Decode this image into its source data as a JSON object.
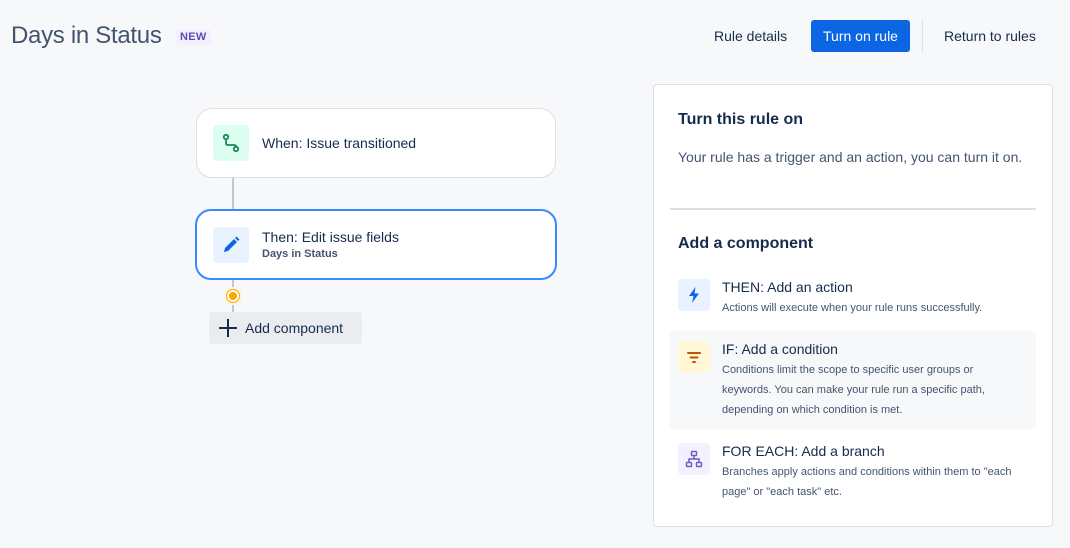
{
  "header": {
    "title": "Days in Status",
    "badge": "NEW",
    "rule_details_label": "Rule details",
    "turn_on_label": "Turn on rule",
    "return_label": "Return to rules"
  },
  "canvas": {
    "trigger": {
      "title": "When: Issue transitioned",
      "icon": "transition-icon"
    },
    "action": {
      "title": "Then: Edit issue fields",
      "subtitle": "Days in Status",
      "icon": "pencil-icon"
    },
    "add_component_label": "Add component"
  },
  "panel": {
    "title": "Turn this rule on",
    "description": "Your rule has a trigger and an action, you can turn it on.",
    "section_title": "Add a component",
    "components": [
      {
        "title": "THEN: Add an action",
        "description": "Actions will execute when your rule runs successfully.",
        "icon": "lightning-icon"
      },
      {
        "title": "IF: Add a condition",
        "description": "Conditions limit the scope to specific user groups or keywords. You can make your rule run a specific path, depending on which condition is met.",
        "icon": "filter-icon"
      },
      {
        "title": "FOR EACH: Add a branch",
        "description": "Branches apply actions and conditions within them to \"each page\" or \"each task\" etc.",
        "icon": "branch-icon"
      }
    ]
  },
  "colors": {
    "primary": "#0c66e4",
    "selected_border": "#388bff",
    "text": "#172b4d",
    "subtle_text": "#44546f"
  }
}
